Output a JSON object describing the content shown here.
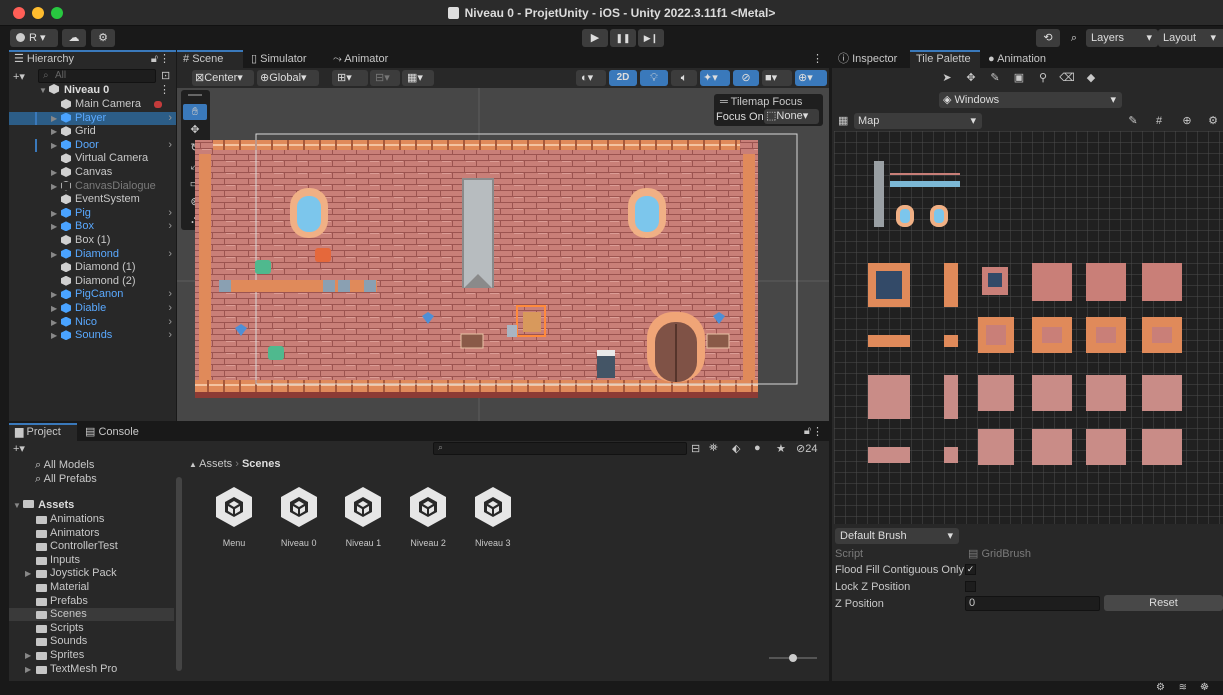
{
  "window": {
    "title": "Niveau 0 - ProjetUnity - iOS - Unity 2022.3.11f1 <Metal>"
  },
  "toolbar": {
    "account": "R ▾",
    "play_icon": "▶",
    "pause_icon": "❚❚",
    "step_icon": "▶❙",
    "history_icon": "⟲",
    "search_icon": "⌕",
    "layers": "Layers",
    "layout": "Layout"
  },
  "hierarchy": {
    "tab": "Hierarchy",
    "search_placeholder": "All",
    "scene": "Niveau 0",
    "items": [
      {
        "label": "Main Camera",
        "style": "w"
      },
      {
        "label": "Player",
        "style": "b"
      },
      {
        "label": "Grid",
        "style": "w"
      },
      {
        "label": "Door",
        "style": "b"
      },
      {
        "label": "Virtual Camera",
        "style": "w"
      },
      {
        "label": "Canvas",
        "style": "w"
      },
      {
        "label": "CanvasDialogue",
        "style": "o"
      },
      {
        "label": "EventSystem",
        "style": "w"
      },
      {
        "label": "Pig",
        "style": "b"
      },
      {
        "label": "Box",
        "style": "b"
      },
      {
        "label": "Box (1)",
        "style": "w"
      },
      {
        "label": "Diamond",
        "style": "b"
      },
      {
        "label": "Diamond (1)",
        "style": "w"
      },
      {
        "label": "Diamond (2)",
        "style": "w"
      },
      {
        "label": "PigCanon",
        "style": "b"
      },
      {
        "label": "Diable",
        "style": "b"
      },
      {
        "label": "Nico",
        "style": "b"
      },
      {
        "label": "Sounds",
        "style": "b"
      }
    ]
  },
  "scene_tabs": {
    "scene": "Scene",
    "simulator": "Simulator",
    "animator": "Animator"
  },
  "scene_toolbar": {
    "center": "Center",
    "global": "Global",
    "mode2d": "2D"
  },
  "tilemap_focus": {
    "title": "Tilemap Focus",
    "label": "Focus On",
    "value": "None"
  },
  "project": {
    "tab_project": "Project",
    "tab_console": "Console",
    "count": "24",
    "favorites": [
      "All Models",
      "All Prefabs"
    ],
    "assets_label": "Assets",
    "folders": [
      "Animations",
      "Animators",
      "ControllerTest",
      "Inputs",
      "Joystick Pack",
      "Material",
      "Prefabs",
      "Scenes",
      "Scripts",
      "Sounds",
      "Sprites",
      "TextMesh Pro"
    ],
    "breadcrumb_root": "Assets",
    "breadcrumb_current": "Scenes",
    "scenes": [
      "Menu",
      "Niveau 0",
      "Niveau 1",
      "Niveau 2",
      "Niveau 3"
    ]
  },
  "inspector": {
    "tab_inspector": "Inspector",
    "tab_tile_palette": "Tile Palette",
    "tab_animation": "Animation",
    "palette": "Windows",
    "tilemap": "Map",
    "brush": "Default Brush",
    "script_label": "Script",
    "script_value": "GridBrush",
    "flood_label": "Flood Fill Contiguous Only",
    "lockz_label": "Lock Z Position",
    "zpos_label": "Z Position",
    "zpos_value": "0",
    "reset": "Reset"
  },
  "colors": {
    "accent": "#3a79bb",
    "selection": "#2c5d87",
    "prefab_blue": "#5aa9ff",
    "brick": "#c97f78",
    "floor": "#e88b57"
  }
}
